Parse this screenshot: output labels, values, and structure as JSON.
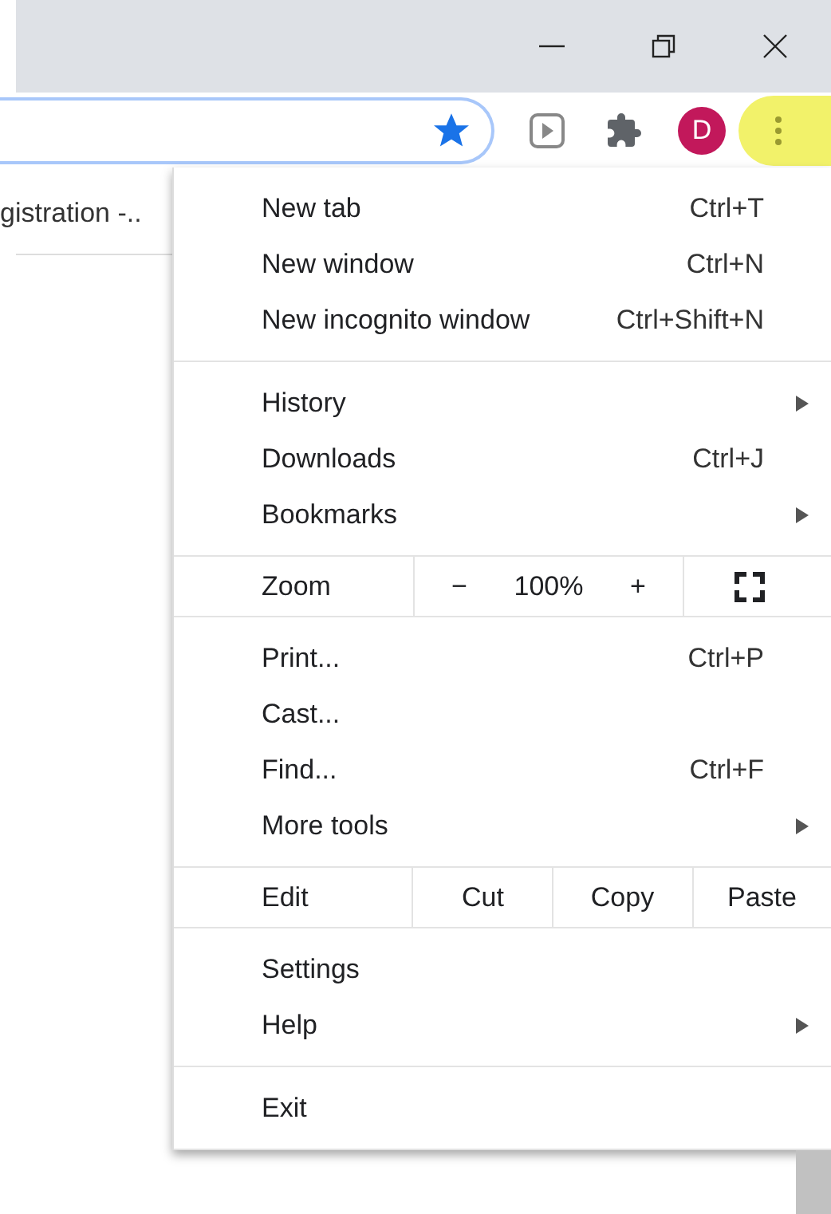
{
  "toolbar": {
    "bookmarked": true,
    "avatar_letter": "D",
    "menu_highlighted": true
  },
  "page": {
    "link_text": "gistration -.."
  },
  "menu": {
    "sections": [
      {
        "kind": "items",
        "items": [
          {
            "label": "New tab",
            "shortcut": "Ctrl+T",
            "submenu": false
          },
          {
            "label": "New window",
            "shortcut": "Ctrl+N",
            "submenu": false
          },
          {
            "label": "New incognito window",
            "shortcut": "Ctrl+Shift+N",
            "submenu": false
          }
        ]
      },
      {
        "kind": "items",
        "items": [
          {
            "label": "History",
            "submenu": true
          },
          {
            "label": "Downloads",
            "shortcut": "Ctrl+J",
            "submenu": false
          },
          {
            "label": "Bookmarks",
            "submenu": true
          }
        ]
      },
      {
        "kind": "zoom",
        "label": "Zoom",
        "minus": "−",
        "value": "100%",
        "plus": "+"
      },
      {
        "kind": "items",
        "items": [
          {
            "label": "Print...",
            "shortcut": "Ctrl+P",
            "submenu": false
          },
          {
            "label": "Cast...",
            "submenu": false
          },
          {
            "label": "Find...",
            "shortcut": "Ctrl+F",
            "submenu": false
          },
          {
            "label": "More tools",
            "submenu": true
          }
        ]
      },
      {
        "kind": "edit",
        "label": "Edit",
        "buttons": [
          "Cut",
          "Copy",
          "Paste"
        ]
      },
      {
        "kind": "items",
        "items": [
          {
            "label": "Settings",
            "submenu": false
          },
          {
            "label": "Help",
            "submenu": true
          }
        ]
      },
      {
        "kind": "items",
        "items": [
          {
            "label": "Exit",
            "submenu": false
          }
        ]
      }
    ]
  }
}
